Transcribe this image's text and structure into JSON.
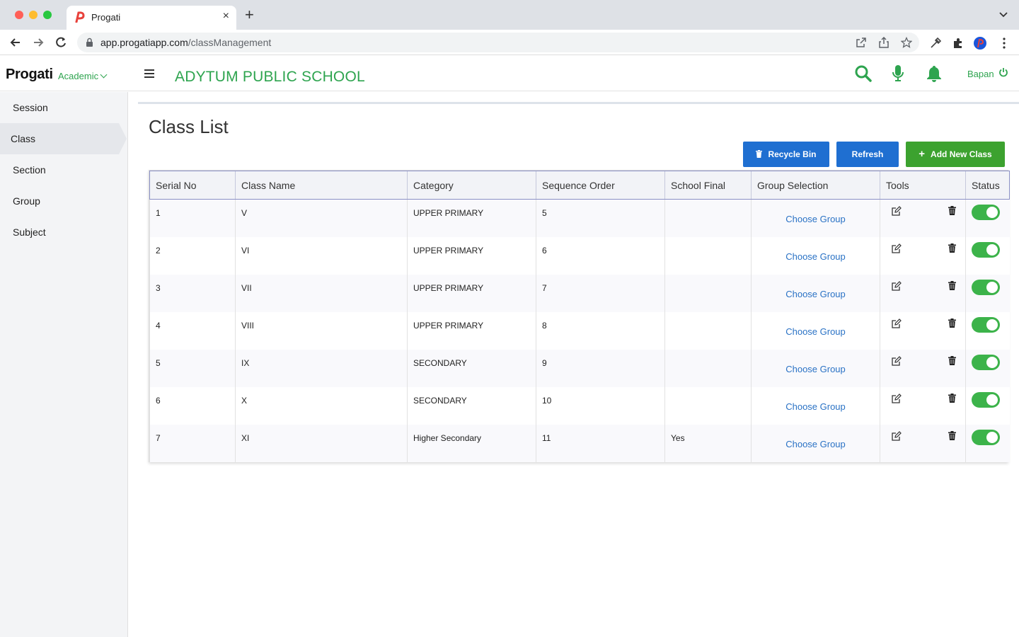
{
  "browser": {
    "tab_title": "Progati",
    "url_host": "app.progatiapp.com",
    "url_path": "/classManagement"
  },
  "header": {
    "brand": "Progati",
    "module": "Academic",
    "school_name": "ADYTUM PUBLIC SCHOOL",
    "user_name": "Bapan"
  },
  "sidebar": {
    "items": [
      {
        "label": "Session"
      },
      {
        "label": "Class"
      },
      {
        "label": "Section"
      },
      {
        "label": "Group"
      },
      {
        "label": "Subject"
      }
    ],
    "active": "Class"
  },
  "main": {
    "title": "Class List",
    "buttons": {
      "recycle_bin": "Recycle Bin",
      "refresh": "Refresh",
      "add_new": "Add New Class"
    },
    "columns": [
      "Serial No",
      "Class Name",
      "Category",
      "Sequence Order",
      "School Final",
      "Group Selection",
      "Tools",
      "Status"
    ],
    "rows": [
      {
        "serial": "1",
        "class_name": "V",
        "category": "UPPER PRIMARY",
        "sequence": "5",
        "school_final": "",
        "group": "Choose Group",
        "status": "on"
      },
      {
        "serial": "2",
        "class_name": "VI",
        "category": "UPPER PRIMARY",
        "sequence": "6",
        "school_final": "",
        "group": "Choose Group",
        "status": "on"
      },
      {
        "serial": "3",
        "class_name": "VII",
        "category": "UPPER PRIMARY",
        "sequence": "7",
        "school_final": "",
        "group": "Choose Group",
        "status": "on"
      },
      {
        "serial": "4",
        "class_name": "VIII",
        "category": "UPPER PRIMARY",
        "sequence": "8",
        "school_final": "",
        "group": "Choose Group",
        "status": "on"
      },
      {
        "serial": "5",
        "class_name": "IX",
        "category": "SECONDARY",
        "sequence": "9",
        "school_final": "",
        "group": "Choose Group",
        "status": "on"
      },
      {
        "serial": "6",
        "class_name": "X",
        "category": "SECONDARY",
        "sequence": "10",
        "school_final": "",
        "group": "Choose Group",
        "status": "on"
      },
      {
        "serial": "7",
        "class_name": "XI",
        "category": "Higher Secondary",
        "sequence": "11",
        "school_final": "Yes",
        "group": "Choose Group",
        "status": "on"
      }
    ]
  },
  "colors": {
    "accent_green": "#2ea44f",
    "button_blue": "#1f6fd1",
    "button_green": "#3ca22f",
    "toggle_on": "#3cb34a",
    "link_blue": "#2a72c5"
  },
  "icons": [
    "search-icon",
    "microphone-icon",
    "bell-icon",
    "power-icon",
    "edit-icon",
    "trash-icon",
    "plus-icon",
    "hamburger-icon"
  ]
}
